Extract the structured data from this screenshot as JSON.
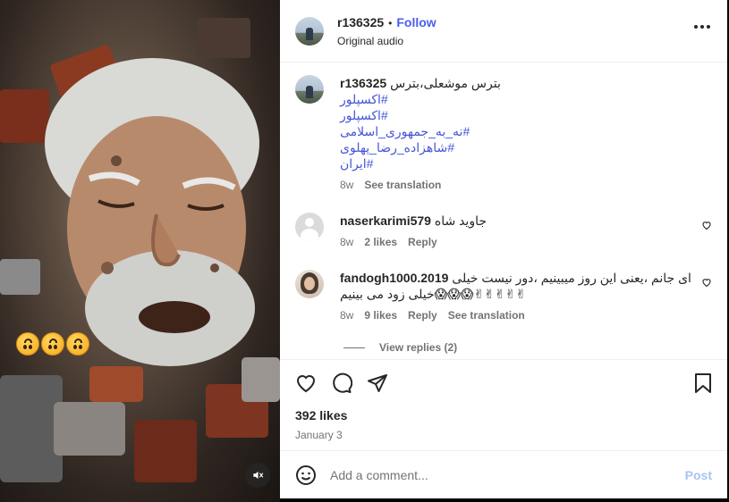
{
  "post": {
    "username": "r136325",
    "follow_label": "Follow",
    "audio": "Original audio",
    "separator": "•"
  },
  "media": {
    "emojis": [
      "upside-down-face",
      "upside-down-face",
      "upside-down-face"
    ],
    "mute_icon": "muted-speaker-icon"
  },
  "caption": {
    "username": "r136325",
    "text": "بترس موشعلی،بترس",
    "hashtags": [
      "#اکسپلور",
      "#اکسپلور",
      "#نه_به_جمهوری_اسلامی",
      "#شاهزاده_رضا_پهلوی",
      "#ایران"
    ],
    "age": "8w",
    "see_translation": "See translation"
  },
  "comments": [
    {
      "username": "naserkarimi579",
      "text": "جاوید شاه",
      "age": "8w",
      "likes": "2 likes",
      "reply": "Reply"
    },
    {
      "username": "fandogh1000.2019",
      "text": "ای جانم ،یعنی این روز میبینیم ،دور نیست خیلی خیلی زود می بینیم😱😱😱✌✌✌✌✌",
      "age": "8w",
      "likes": "9 likes",
      "reply": "Reply",
      "see_translation": "See translation",
      "view_replies": "View replies (2)"
    }
  ],
  "engagement": {
    "likes": "392 likes",
    "date": "January 3"
  },
  "add_comment": {
    "placeholder": "Add a comment...",
    "post_label": "Post"
  },
  "colors": {
    "link": "#4656d6",
    "follow": "#4a5df0",
    "muted": "#737373",
    "post_disabled": "#a8c4f0"
  }
}
